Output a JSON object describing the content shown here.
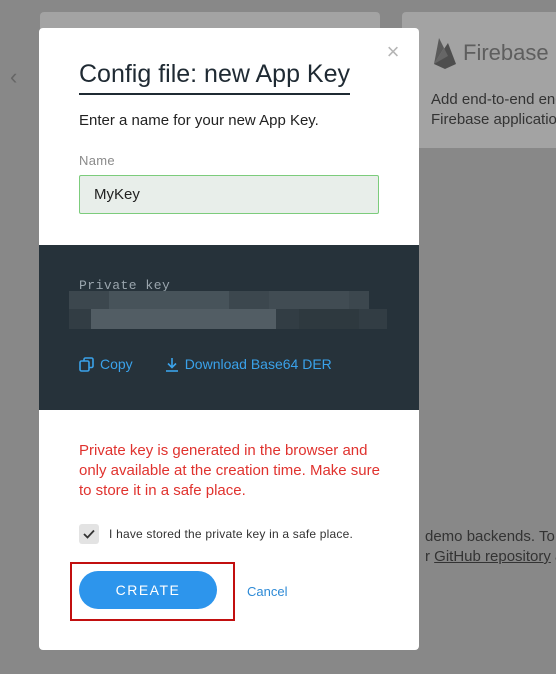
{
  "background": {
    "firebase_title": "Firebase",
    "firebase_desc_line1": "Add end-to-end enc",
    "firebase_desc_line2": "Firebase application",
    "text_line1": "demo backends. To c",
    "text_line2_prefix": "r ",
    "text_line2_link": "GitHub repository",
    "text_line2_suffix": " a"
  },
  "modal": {
    "title": "Config file: new App Key",
    "subtitle": "Enter a name for your new App Key.",
    "name_label": "Name",
    "name_value": "MyKey",
    "private_key_label": "Private key",
    "copy_label": "Copy",
    "download_label": "Download Base64 DER",
    "warning": "Private key is generated in the browser and only available at the creation time. Make sure to store it in a safe place.",
    "confirm_text": "I have stored the private key in a safe place.",
    "confirm_checked": true,
    "create_label": "CREATE",
    "cancel_label": "Cancel"
  },
  "colors": {
    "accent": "#2d95ec",
    "warning": "#e0322e",
    "panel_dark": "#26323a",
    "highlight": "#c20f0f"
  }
}
